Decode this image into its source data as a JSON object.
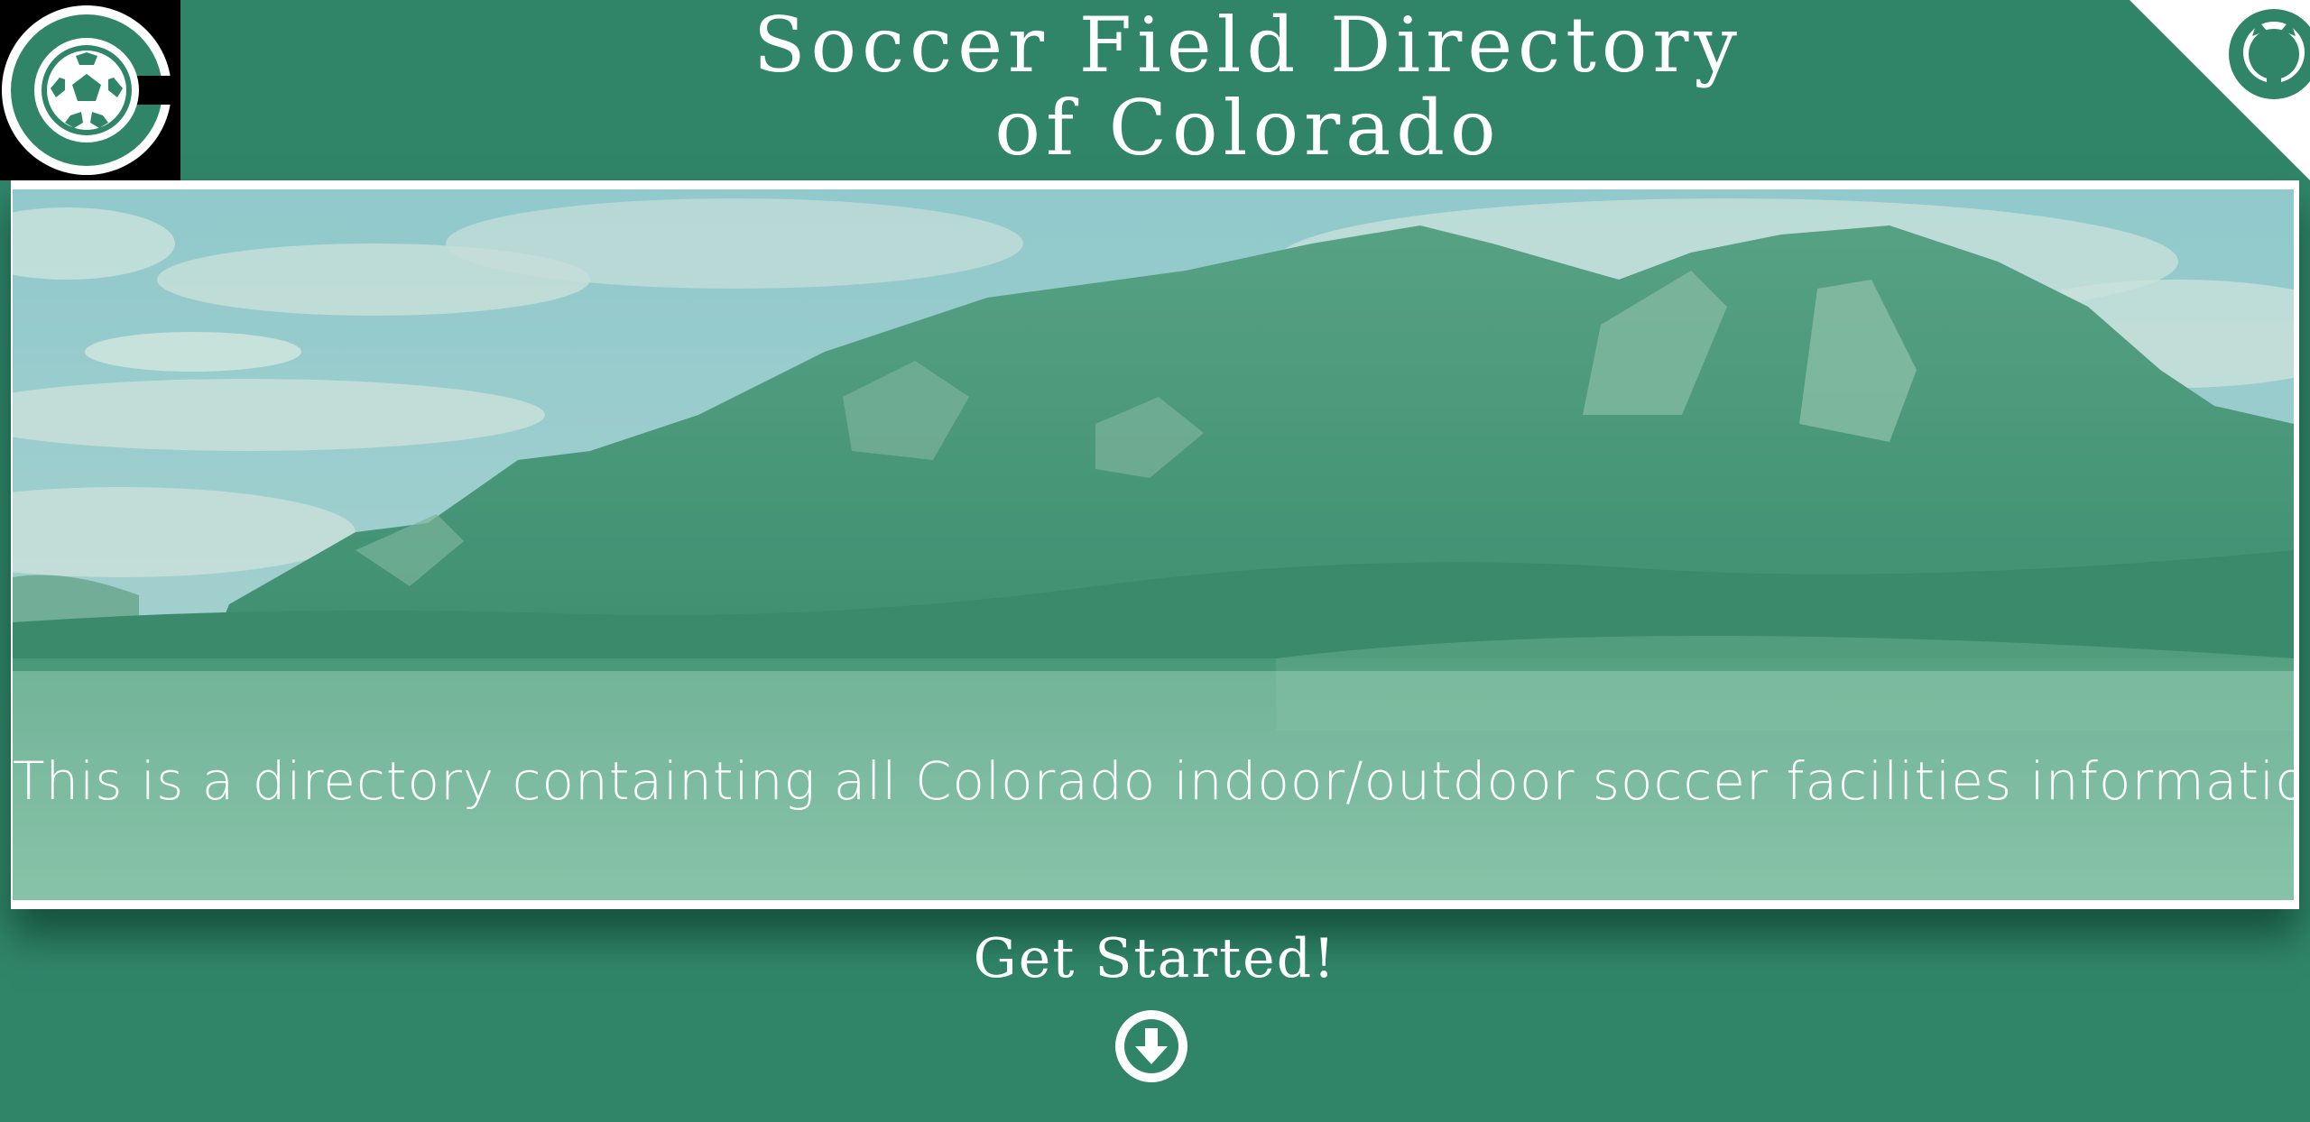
{
  "header": {
    "title_line1": "Soccer Field Directory",
    "title_line2": "of Colorado"
  },
  "logo": {
    "icon": "colorado-soccer-ball-logo"
  },
  "corner": {
    "icon": "github-octocat-icon"
  },
  "hero": {
    "tagline": "This is a directory containting all Colorado indoor/outdoor soccer facilities information."
  },
  "cta": {
    "label": "Get Started!",
    "icon": "arrow-down-circle-icon"
  },
  "colors": {
    "primary": "#308569",
    "white": "#ffffff",
    "black": "#000000"
  }
}
